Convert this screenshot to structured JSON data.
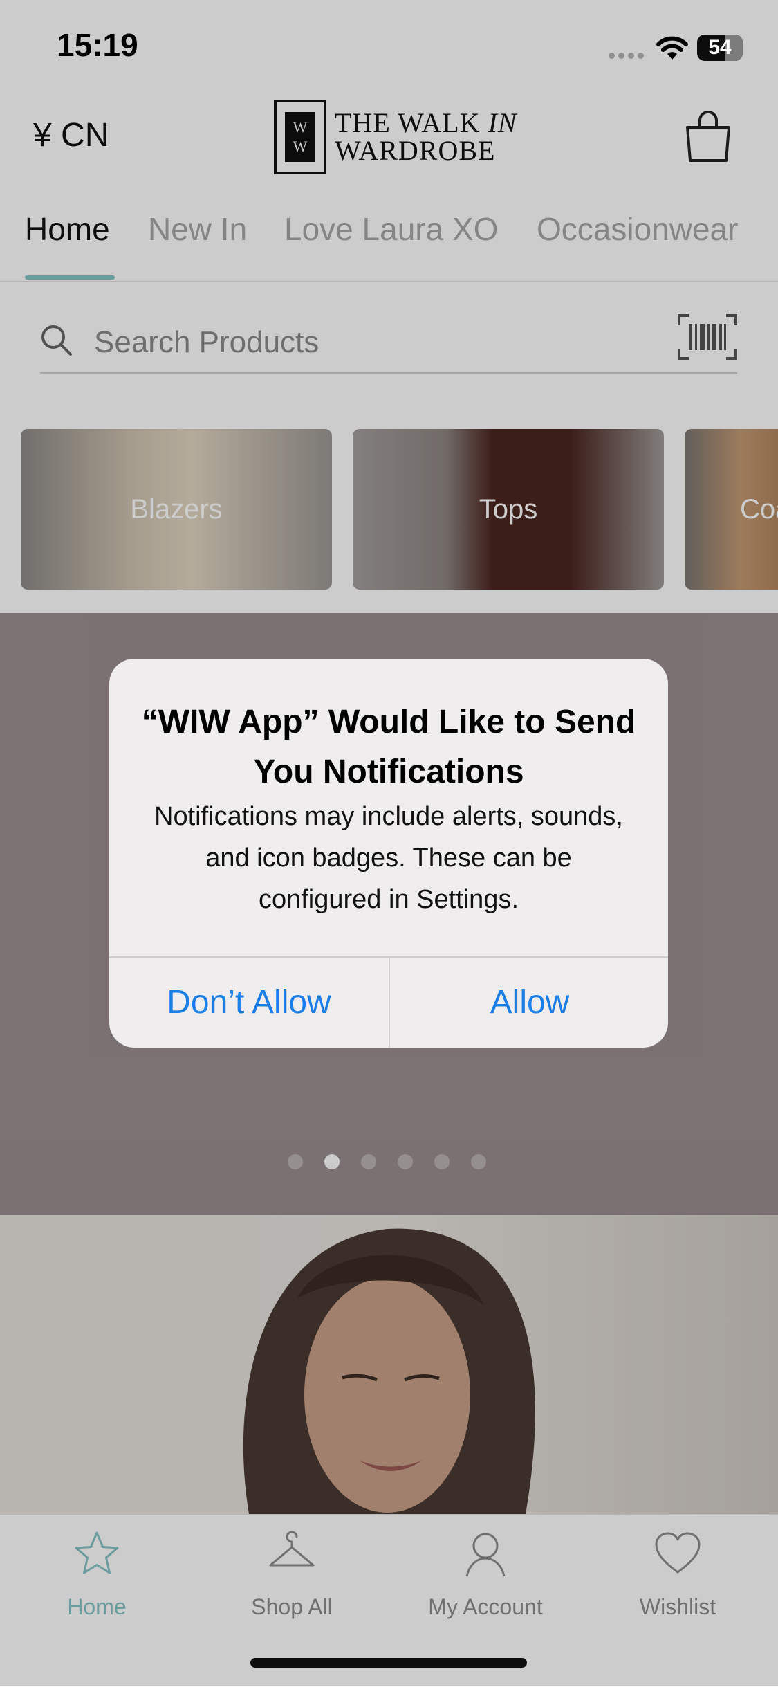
{
  "status_bar": {
    "time": "15:19",
    "battery": "54"
  },
  "header": {
    "currency": "¥ CN",
    "logo": {
      "line1_a": "THE WALK ",
      "line1_b": "IN",
      "line2": "WARDROBE",
      "monogram": "WIW"
    }
  },
  "tabs": [
    {
      "label": "Home",
      "active": true
    },
    {
      "label": "New In",
      "active": false
    },
    {
      "label": "Love Laura XO",
      "active": false
    },
    {
      "label": "Occasionwear",
      "active": false
    }
  ],
  "search": {
    "placeholder": "Search Products"
  },
  "categories": [
    {
      "label": "Blazers"
    },
    {
      "label": "Tops"
    },
    {
      "label": "Coats"
    }
  ],
  "carousel": {
    "count": 6,
    "active_index": 1
  },
  "alert": {
    "title": "“WIW App” Would Like to Send You Notifications",
    "message": "Notifications may include alerts, sounds, and icon badges. These can be configured in Settings.",
    "deny_label": "Don’t Allow",
    "allow_label": "Allow"
  },
  "tab_bar": [
    {
      "label": "Home",
      "icon": "star-icon",
      "active": true
    },
    {
      "label": "Shop All",
      "icon": "hanger-icon",
      "active": false
    },
    {
      "label": "My Account",
      "icon": "user-icon",
      "active": false
    },
    {
      "label": "Wishlist",
      "icon": "heart-icon",
      "active": false
    }
  ],
  "colors": {
    "accent": "#87c3c6",
    "alert_button": "#1a7ee6",
    "banner": "#9a8e8f"
  }
}
